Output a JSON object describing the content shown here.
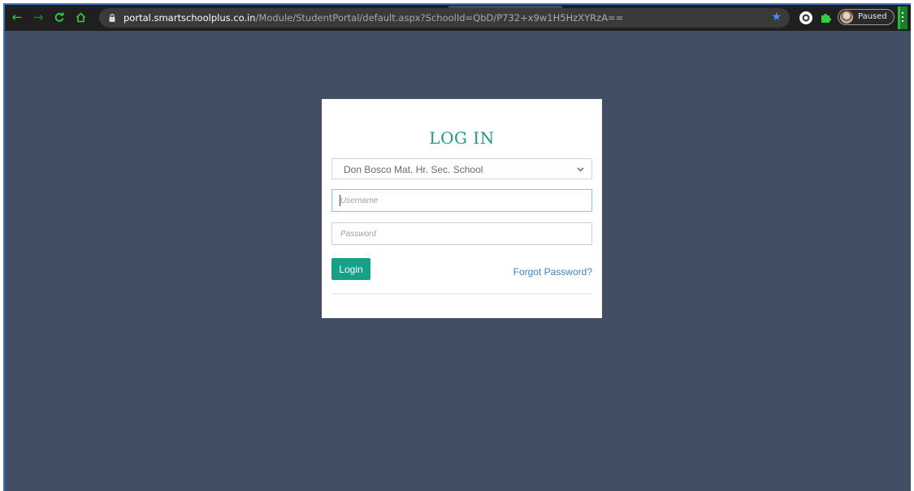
{
  "browser": {
    "url_host": "portal.smartschoolplus.co.in",
    "url_path": "/Module/StudentPortal/default.aspx?SchoolId=QbD/P732+x9w1H5HzXYRzA==",
    "profile_status": "Paused",
    "icons": [
      "back-icon",
      "forward-icon",
      "reload-icon",
      "home-icon",
      "lock-icon",
      "star-icon",
      "extension-icon",
      "puzzle-icon",
      "avatar",
      "menu-icon"
    ]
  },
  "login": {
    "title": "LOG IN",
    "school_select": {
      "selected": "Don Bosco Mat. Hr. Sec. School"
    },
    "username": {
      "placeholder": "Username",
      "value": ""
    },
    "password": {
      "placeholder": "Password",
      "value": ""
    },
    "login_button": "Login",
    "forgot_link": "Forgot Password?"
  },
  "colors": {
    "page_background": "#414e64",
    "accent": "#16a085",
    "link": "#3b83c4",
    "toolbar": "#1f1f1f"
  }
}
